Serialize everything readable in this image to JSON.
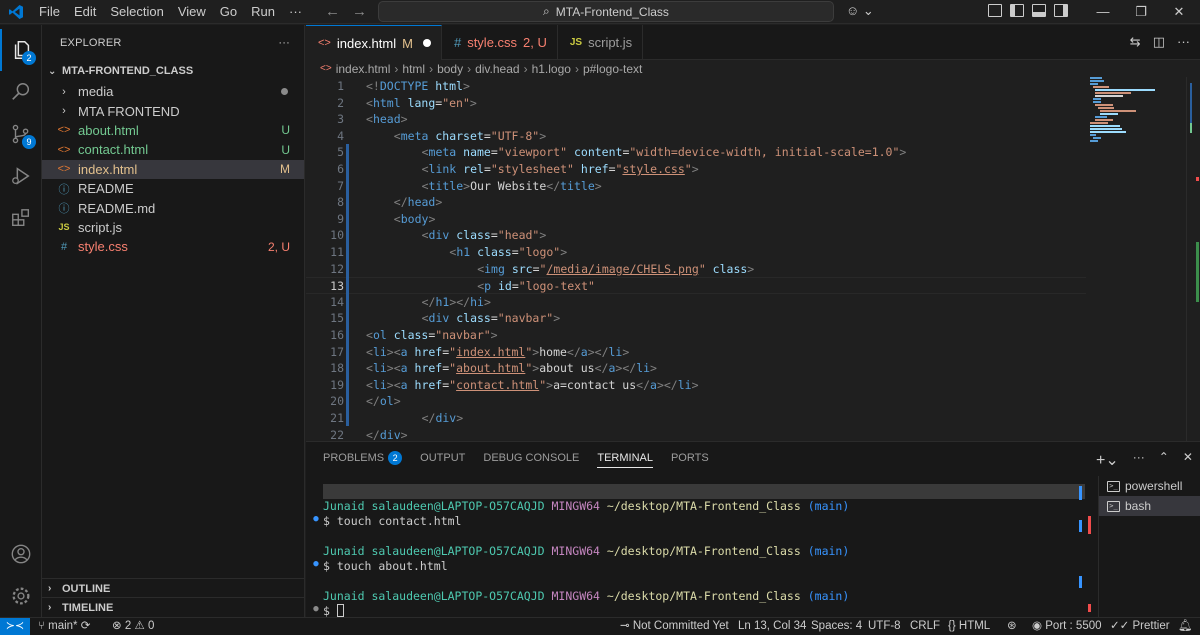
{
  "titlebar": {
    "menu": [
      "File",
      "Edit",
      "Selection",
      "View",
      "Go",
      "Run",
      "···"
    ],
    "search_text": "MTA-Frontend_Class"
  },
  "activity_bar": {
    "explorer_badge": "2",
    "scm_badge": "9"
  },
  "sidebar": {
    "title": "EXPLORER",
    "more": "···",
    "folder": "MTA-FRONTEND_CLASS",
    "items": [
      {
        "label": "media",
        "kind": "folder",
        "status": "",
        "icon": "chevron-right"
      },
      {
        "label": "MTA FRONTEND",
        "kind": "folder",
        "status": "",
        "icon": "chevron-right"
      },
      {
        "label": "about.html",
        "kind": "html",
        "status": "U",
        "icon": "html-icon"
      },
      {
        "label": "contact.html",
        "kind": "html",
        "status": "U",
        "icon": "html-icon"
      },
      {
        "label": "index.html",
        "kind": "html",
        "status": "M",
        "icon": "html-icon"
      },
      {
        "label": "README",
        "kind": "info",
        "status": "",
        "icon": "info-icon"
      },
      {
        "label": "README.md",
        "kind": "info",
        "status": "",
        "icon": "info-icon"
      },
      {
        "label": "script.js",
        "kind": "js",
        "status": "",
        "icon": "js-icon"
      },
      {
        "label": "style.css",
        "kind": "css",
        "status": "2, U",
        "icon": "css-icon"
      }
    ],
    "outline": "OUTLINE",
    "timeline": "TIMELINE"
  },
  "tabs": [
    {
      "icon": "<>",
      "label": "index.html",
      "status": "M",
      "active": true
    },
    {
      "icon": "#",
      "label": "style.css",
      "status": "2, U",
      "active": false
    },
    {
      "icon": "JS",
      "label": "script.js",
      "status": "",
      "active": false
    }
  ],
  "breadcrumb": [
    "index.html",
    "html",
    "body",
    "div.head",
    "h1.logo",
    "p#logo-text"
  ],
  "editor": {
    "current_line": 13,
    "lines": [
      {
        "n": "1",
        "indent": 0,
        "tokens": [
          [
            "t-punc",
            "<!"
          ],
          [
            "t-doc",
            "DOCTYPE "
          ],
          [
            "t-attr",
            "html"
          ],
          [
            "t-punc",
            ">"
          ]
        ]
      },
      {
        "n": "2",
        "indent": 0,
        "tokens": [
          [
            "t-punc",
            "<"
          ],
          [
            "t-tag",
            "html "
          ],
          [
            "t-attr",
            "lang"
          ],
          [
            "t-txt",
            "="
          ],
          [
            "t-str",
            "\"en\""
          ],
          [
            "t-punc",
            ">"
          ]
        ]
      },
      {
        "n": "3",
        "indent": 0,
        "tokens": [
          [
            "t-punc",
            "<"
          ],
          [
            "t-tag",
            "head"
          ],
          [
            "t-punc",
            ">"
          ]
        ]
      },
      {
        "n": "4",
        "indent": 4,
        "tokens": [
          [
            "t-punc",
            "<"
          ],
          [
            "t-tag",
            "meta "
          ],
          [
            "t-attr",
            "charset"
          ],
          [
            "t-txt",
            "="
          ],
          [
            "t-str",
            "\"UTF-8\""
          ],
          [
            "t-punc",
            ">"
          ]
        ]
      },
      {
        "n": "5",
        "indent": 8,
        "tokens": [
          [
            "t-punc",
            "<"
          ],
          [
            "t-tag",
            "meta "
          ],
          [
            "t-attr",
            "name"
          ],
          [
            "t-txt",
            "="
          ],
          [
            "t-str",
            "\"viewport\" "
          ],
          [
            "t-attr",
            "content"
          ],
          [
            "t-txt",
            "="
          ],
          [
            "t-str",
            "\"width=device-width, initial-scale=1.0\""
          ],
          [
            "t-punc",
            ">"
          ]
        ]
      },
      {
        "n": "6",
        "indent": 8,
        "tokens": [
          [
            "t-punc",
            "<"
          ],
          [
            "t-tag",
            "link "
          ],
          [
            "t-attr",
            "rel"
          ],
          [
            "t-txt",
            "="
          ],
          [
            "t-str",
            "\"stylesheet\" "
          ],
          [
            "t-attr",
            "href"
          ],
          [
            "t-txt",
            "="
          ],
          [
            "t-str",
            "\""
          ],
          [
            "t-str t-link",
            "style.css"
          ],
          [
            "t-str",
            "\""
          ],
          [
            "t-punc",
            ">"
          ]
        ]
      },
      {
        "n": "7",
        "indent": 8,
        "tokens": [
          [
            "t-punc",
            "<"
          ],
          [
            "t-tag",
            "title"
          ],
          [
            "t-punc",
            ">"
          ],
          [
            "t-txt",
            "Our Website"
          ],
          [
            "t-punc",
            "</"
          ],
          [
            "t-tag",
            "title"
          ],
          [
            "t-punc",
            ">"
          ]
        ]
      },
      {
        "n": "8",
        "indent": 4,
        "tokens": [
          [
            "t-punc",
            "</"
          ],
          [
            "t-tag",
            "head"
          ],
          [
            "t-punc",
            ">"
          ]
        ]
      },
      {
        "n": "9",
        "indent": 4,
        "tokens": [
          [
            "t-punc",
            "<"
          ],
          [
            "t-tag",
            "body"
          ],
          [
            "t-punc",
            ">"
          ]
        ]
      },
      {
        "n": "10",
        "indent": 8,
        "tokens": [
          [
            "t-punc",
            "<"
          ],
          [
            "t-tag",
            "div "
          ],
          [
            "t-attr",
            "class"
          ],
          [
            "t-txt",
            "="
          ],
          [
            "t-str",
            "\"head\""
          ],
          [
            "t-punc",
            ">"
          ]
        ]
      },
      {
        "n": "11",
        "indent": 12,
        "tokens": [
          [
            "t-punc",
            "<"
          ],
          [
            "t-tag",
            "h1 "
          ],
          [
            "t-attr",
            "class"
          ],
          [
            "t-txt",
            "="
          ],
          [
            "t-str",
            "\"logo\""
          ],
          [
            "t-punc",
            ">"
          ]
        ]
      },
      {
        "n": "12",
        "indent": 16,
        "tokens": [
          [
            "t-punc",
            "<"
          ],
          [
            "t-tag",
            "img "
          ],
          [
            "t-attr",
            "src"
          ],
          [
            "t-txt",
            "="
          ],
          [
            "t-str",
            "\""
          ],
          [
            "t-str t-link",
            "/media/image/CHELS.png"
          ],
          [
            "t-str",
            "\" "
          ],
          [
            "t-attr",
            "class"
          ],
          [
            "t-punc",
            ">"
          ]
        ]
      },
      {
        "n": "13",
        "indent": 16,
        "tokens": [
          [
            "t-punc",
            "<"
          ],
          [
            "t-tag",
            "p "
          ],
          [
            "t-attr",
            "id"
          ],
          [
            "t-txt",
            "="
          ],
          [
            "t-str",
            "\"logo-text\""
          ]
        ]
      },
      {
        "n": "14",
        "indent": 8,
        "tokens": [
          [
            "t-punc",
            "</"
          ],
          [
            "t-tag",
            "h1"
          ],
          [
            "t-punc",
            "></"
          ],
          [
            "t-tag",
            "hi"
          ],
          [
            "t-punc",
            ">"
          ]
        ]
      },
      {
        "n": "15",
        "indent": 8,
        "tokens": [
          [
            "t-punc",
            "<"
          ],
          [
            "t-tag",
            "div "
          ],
          [
            "t-attr",
            "class"
          ],
          [
            "t-txt",
            "="
          ],
          [
            "t-str",
            "\"navbar\""
          ],
          [
            "t-punc",
            ">"
          ]
        ]
      },
      {
        "n": "16",
        "indent": 0,
        "tokens": [
          [
            "t-punc",
            "<"
          ],
          [
            "t-tag",
            "ol "
          ],
          [
            "t-attr",
            "class"
          ],
          [
            "t-txt",
            "="
          ],
          [
            "t-str",
            "\"navbar\""
          ],
          [
            "t-punc",
            ">"
          ]
        ]
      },
      {
        "n": "17",
        "indent": 0,
        "tokens": [
          [
            "t-punc",
            "<"
          ],
          [
            "t-tag",
            "li"
          ],
          [
            "t-punc",
            "><"
          ],
          [
            "t-tag",
            "a "
          ],
          [
            "t-attr",
            "href"
          ],
          [
            "t-txt",
            "="
          ],
          [
            "t-str",
            "\""
          ],
          [
            "t-str t-link",
            "index.html"
          ],
          [
            "t-str",
            "\""
          ],
          [
            "t-punc",
            ">"
          ],
          [
            "t-txt",
            "home"
          ],
          [
            "t-punc",
            "</"
          ],
          [
            "t-tag",
            "a"
          ],
          [
            "t-punc",
            "></"
          ],
          [
            "t-tag",
            "li"
          ],
          [
            "t-punc",
            ">"
          ]
        ]
      },
      {
        "n": "18",
        "indent": 0,
        "tokens": [
          [
            "t-punc",
            "<"
          ],
          [
            "t-tag",
            "li"
          ],
          [
            "t-punc",
            "><"
          ],
          [
            "t-tag",
            "a "
          ],
          [
            "t-attr",
            "href"
          ],
          [
            "t-txt",
            "="
          ],
          [
            "t-str",
            "\""
          ],
          [
            "t-str t-link",
            "about.html"
          ],
          [
            "t-str",
            "\""
          ],
          [
            "t-punc",
            ">"
          ],
          [
            "t-txt",
            "about us"
          ],
          [
            "t-punc",
            "</"
          ],
          [
            "t-tag",
            "a"
          ],
          [
            "t-punc",
            "></"
          ],
          [
            "t-tag",
            "li"
          ],
          [
            "t-punc",
            ">"
          ]
        ]
      },
      {
        "n": "19",
        "indent": 0,
        "tokens": [
          [
            "t-punc",
            "<"
          ],
          [
            "t-tag",
            "li"
          ],
          [
            "t-punc",
            "><"
          ],
          [
            "t-tag",
            "a "
          ],
          [
            "t-attr",
            "href"
          ],
          [
            "t-txt",
            "="
          ],
          [
            "t-str",
            "\""
          ],
          [
            "t-str t-link",
            "contact.html"
          ],
          [
            "t-str",
            "\""
          ],
          [
            "t-punc",
            ">"
          ],
          [
            "t-txt",
            "a=contact us"
          ],
          [
            "t-punc",
            "</"
          ],
          [
            "t-tag",
            "a"
          ],
          [
            "t-punc",
            "></"
          ],
          [
            "t-tag",
            "li"
          ],
          [
            "t-punc",
            ">"
          ]
        ]
      },
      {
        "n": "20",
        "indent": 0,
        "tokens": [
          [
            "t-punc",
            "</"
          ],
          [
            "t-tag",
            "ol"
          ],
          [
            "t-punc",
            ">"
          ]
        ]
      },
      {
        "n": "21",
        "indent": 8,
        "tokens": [
          [
            "t-punc",
            "</"
          ],
          [
            "t-tag",
            "div"
          ],
          [
            "t-punc",
            ">"
          ]
        ]
      },
      {
        "n": "22",
        "indent": 0,
        "tokens": [
          [
            "t-punc",
            "</"
          ],
          [
            "t-tag",
            "div"
          ],
          [
            "t-punc",
            ">"
          ]
        ]
      }
    ]
  },
  "panel": {
    "tabs": [
      {
        "label": "PROBLEMS",
        "badge": "2",
        "active": false
      },
      {
        "label": "OUTPUT",
        "badge": "",
        "active": false
      },
      {
        "label": "DEBUG CONSOLE",
        "badge": "",
        "active": false
      },
      {
        "label": "TERMINAL",
        "badge": "",
        "active": true
      },
      {
        "label": "PORTS",
        "badge": "",
        "active": false
      }
    ],
    "terminal_lines": [
      {
        "type": "prompt",
        "user": "Junaid salaudeen@LAPTOP-O57CAQJD",
        "env": "MINGW64",
        "path": "~/desktop/MTA-Frontend_Class",
        "branch": "(main)"
      },
      {
        "type": "cmd",
        "text": "$ touch contact.html"
      },
      {
        "type": "blank"
      },
      {
        "type": "prompt",
        "user": "Junaid salaudeen@LAPTOP-O57CAQJD",
        "env": "MINGW64",
        "path": "~/desktop/MTA-Frontend_Class",
        "branch": "(main)"
      },
      {
        "type": "cmd",
        "text": "$ touch about.html"
      },
      {
        "type": "blank"
      },
      {
        "type": "prompt",
        "user": "Junaid salaudeen@LAPTOP-O57CAQJD",
        "env": "MINGW64",
        "path": "~/desktop/MTA-Frontend_Class",
        "branch": "(main)"
      },
      {
        "type": "input",
        "text": "$ "
      }
    ],
    "terminals": [
      {
        "label": "powershell",
        "selected": false
      },
      {
        "label": "bash",
        "selected": true
      }
    ]
  },
  "statusbar": {
    "branch": "main*",
    "errors": "2",
    "warnings": "0",
    "commit": "Not Committed Yet",
    "position": "Ln 13, Col 34",
    "spaces": "Spaces: 4",
    "encoding": "UTF-8",
    "eol": "CRLF",
    "language": "HTML",
    "port": "Port : 5500",
    "prettier": "Prettier"
  },
  "colors": {
    "accent": "#0078d4",
    "background": "#1f1f1f",
    "sidebar": "#181818"
  }
}
